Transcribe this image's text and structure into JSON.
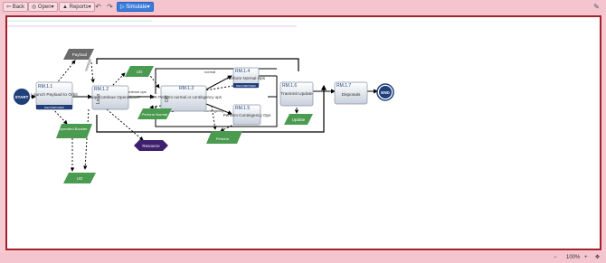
{
  "toolbar": {
    "back": "Back",
    "open": "Open",
    "reports": "Reports",
    "simulate": "Simulate",
    "undo_icon": "undo-icon",
    "redo_icon": "redo-icon",
    "wrench_icon": "wrench-icon"
  },
  "diagram": {
    "start": "START",
    "end": "END",
    "payload": "Payload",
    "expended_booster": "Expended Booster",
    "uo_top": "UO",
    "uo_bottom": "UO",
    "resource": "Resource",
    "perform_normal_out": "Perform Normal",
    "perform_out": "Perform",
    "update": "Update",
    "decomposed": "DECOMPOSED",
    "loop": "Loop",
    "or": "OR",
    "nodes": {
      "rm11": {
        "id": "RM.1.1",
        "title": "Launch Payload to Orbit"
      },
      "rm12": {
        "id": "RM.1.2",
        "title": "Loop Continue Operations?"
      },
      "rm13": {
        "id": "RM.1.3",
        "title": "OR Perform normal or contingency ops"
      },
      "rm14": {
        "id": "RM.1.4",
        "title": "Perform Normal Ops"
      },
      "rm15": {
        "id": "RM.1.5",
        "title": "Perform Contingency Ops"
      },
      "rm16": {
        "id": "RM.1.6",
        "title": "Transmit Update"
      },
      "rm17": {
        "id": "RM.1.7",
        "title": "Disposals"
      }
    },
    "edge_labels": {
      "continue_ops": "continue ops",
      "release_ops": "release ops",
      "normal": "normal",
      "contingency": "contingency",
      "nominal": "nominal"
    }
  },
  "status": {
    "zoom": "100%",
    "minus": "−",
    "plus": "+",
    "fit_icon": "fit-icon"
  },
  "colors": {
    "accent": "#3b7ddd",
    "frame": "#a3222c",
    "start_node": "#1f3f7a",
    "green_io": "#4a9a4f",
    "gray_io": "#6a6a6a",
    "resource": "#3d1f6e"
  }
}
